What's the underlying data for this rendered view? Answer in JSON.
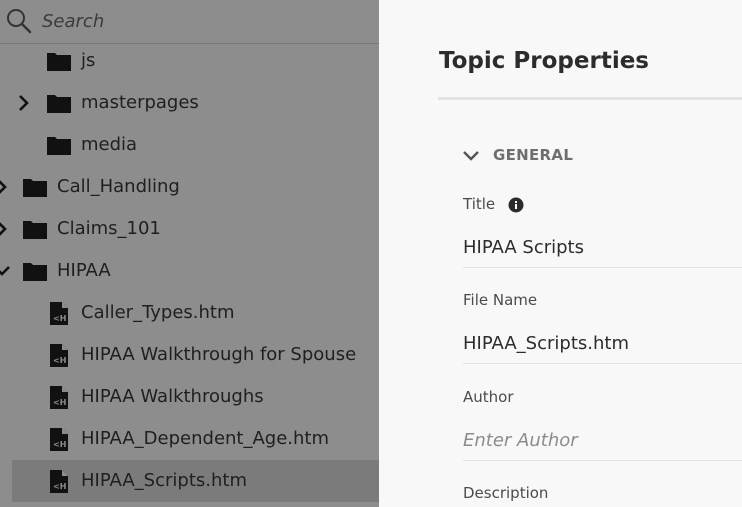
{
  "search": {
    "placeholder": "Search",
    "value": ""
  },
  "tree": [
    {
      "label": "js",
      "type": "folder",
      "chevron": "none",
      "selected": false
    },
    {
      "label": "masterpages",
      "type": "folder",
      "chevron": "right",
      "selected": false
    },
    {
      "label": "media",
      "type": "folder",
      "chevron": "none",
      "selected": false
    },
    {
      "label": "Call_Handling",
      "type": "folder",
      "chevron": "right",
      "selected": false
    },
    {
      "label": "Claims_101",
      "type": "folder",
      "chevron": "right",
      "selected": false
    },
    {
      "label": "HIPAA",
      "type": "folder",
      "chevron": "down",
      "selected": false
    },
    {
      "label": "Caller_Types.htm",
      "type": "file",
      "chevron": "none",
      "selected": false
    },
    {
      "label": "HIPAA Walkthrough for Spouse",
      "type": "file",
      "chevron": "none",
      "selected": false
    },
    {
      "label": "HIPAA Walkthroughs",
      "type": "file",
      "chevron": "none",
      "selected": false
    },
    {
      "label": "HIPAA_Dependent_Age.htm",
      "type": "file",
      "chevron": "none",
      "selected": false
    },
    {
      "label": "HIPAA_Scripts.htm",
      "type": "file",
      "chevron": "none",
      "selected": true
    }
  ],
  "properties": {
    "title": "Topic Properties",
    "section": "GENERAL",
    "fields": {
      "title_label": "Title",
      "title_value": "HIPAA Scripts",
      "filename_label": "File Name",
      "filename_value": "HIPAA_Scripts.htm",
      "author_label": "Author",
      "author_placeholder": "Enter Author",
      "author_value": "",
      "description_label": "Description"
    }
  },
  "colors": {
    "overlay": "#8d8d8d",
    "selected_row": "#7b7b7b",
    "panel_bg": "#f8f8f8",
    "text_dark": "#2c2c2c"
  },
  "icons": [
    "search-icon",
    "folder-icon",
    "file-htm-icon",
    "chevron-right-icon",
    "chevron-down-icon",
    "info-icon"
  ]
}
